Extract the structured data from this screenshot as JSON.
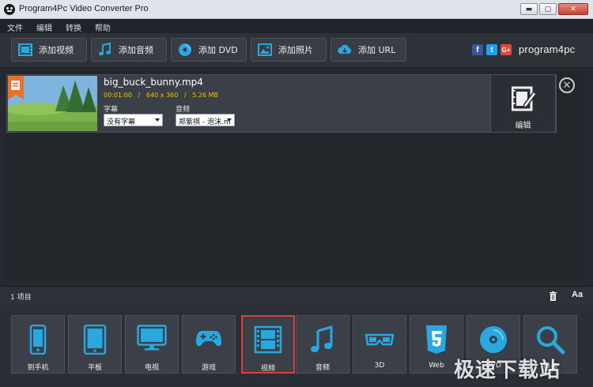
{
  "window": {
    "title": "Program4Pc Video Converter Pro"
  },
  "menu": [
    "文件",
    "编辑",
    "转换",
    "帮助"
  ],
  "toolbar": {
    "add_video": "添加视频",
    "add_audio": "添加音频",
    "add_dvd": "添加 DVD",
    "add_photo": "添加照片",
    "add_url": "添加 URL"
  },
  "brand": {
    "name": "program4pc",
    "social": [
      "f",
      "t",
      "G+"
    ]
  },
  "file": {
    "name": "big_buck_bunny.mp4",
    "duration": "00:01:00",
    "resolution": "640 x 360",
    "size": "5.26 MB",
    "sep": "/",
    "subtitle_label": "字幕",
    "subtitle_value": "没有字幕",
    "audio_label": "音频",
    "audio_value": "郑紫祺 - 泡沫.m",
    "edit_label": "编辑"
  },
  "status": {
    "count": "1 项目",
    "font_button": "Aa"
  },
  "devices": [
    {
      "label": "到手机",
      "icon": "phone-icon"
    },
    {
      "label": "平板",
      "icon": "tablet-icon"
    },
    {
      "label": "电视",
      "icon": "tv-icon"
    },
    {
      "label": "游戏",
      "icon": "gamepad-icon"
    },
    {
      "label": "视频",
      "icon": "film-icon",
      "selected": true
    },
    {
      "label": "音频",
      "icon": "music-icon"
    },
    {
      "label": "3D",
      "icon": "3d-glasses-icon"
    },
    {
      "label": "Web",
      "icon": "html5-icon"
    },
    {
      "label": "DVD",
      "icon": "disc-icon"
    },
    {
      "label": "更多",
      "icon": "search-icon"
    }
  ],
  "watermark": "极速下载站",
  "colors": {
    "accent": "#29a8e0",
    "selected_border": "#e03c3c",
    "meta_text": "#f2c200"
  }
}
